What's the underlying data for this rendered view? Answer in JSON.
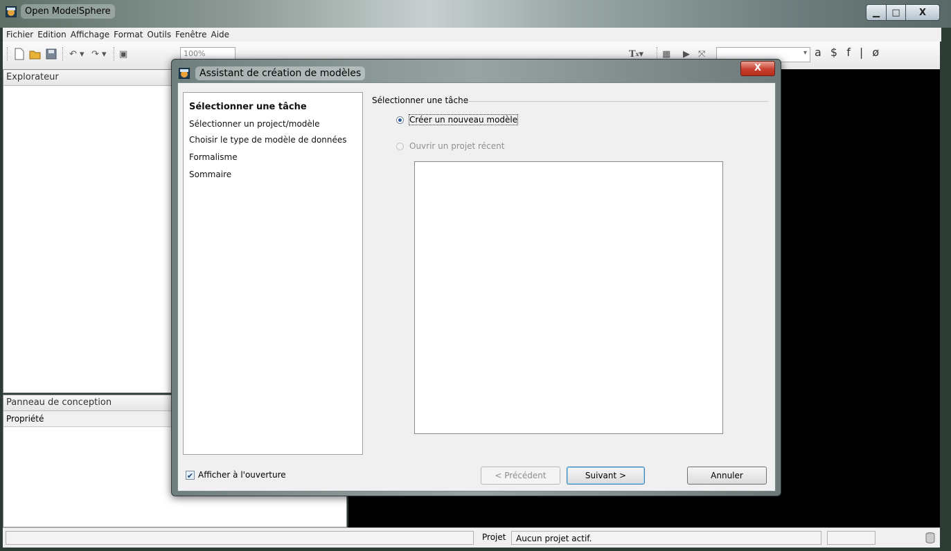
{
  "window": {
    "title": "Open ModelSphere",
    "controls": {
      "minimize": "▁",
      "maximize": "□",
      "close": "X"
    }
  },
  "menu": [
    "Fichier",
    "Edition",
    "Affichage",
    "Format",
    "Outils",
    "Fenêtre",
    "Aide"
  ],
  "toolbar": {
    "zoom": "100%",
    "right_symbols": [
      "a",
      "$",
      "f",
      "|",
      "ø"
    ]
  },
  "explorer": {
    "title": "Explorateur"
  },
  "design_panel": {
    "title": "Panneau de conception",
    "column": "Propriété"
  },
  "statusbar": {
    "label": "Projet",
    "value": "Aucun projet actif."
  },
  "dialog": {
    "title": "Assistant de création de modèles",
    "close_label": "X",
    "steps": [
      "Sélectionner une tâche",
      "Sélectionner un project/modèle",
      "Choisir le type de modèle de données",
      "Formalisme",
      "Sommaire"
    ],
    "active_step": 0,
    "group_title": "Sélectionner une tâche",
    "option_create": "Créer un nouveau modèle",
    "option_open": "Ouvrir un projet récent",
    "selected_option": "create",
    "show_on_startup": "Afficher à l'ouverture",
    "show_on_startup_checked": true,
    "buttons": {
      "previous": "< Précédent",
      "next": "Suivant >",
      "cancel": "Annuler"
    }
  }
}
